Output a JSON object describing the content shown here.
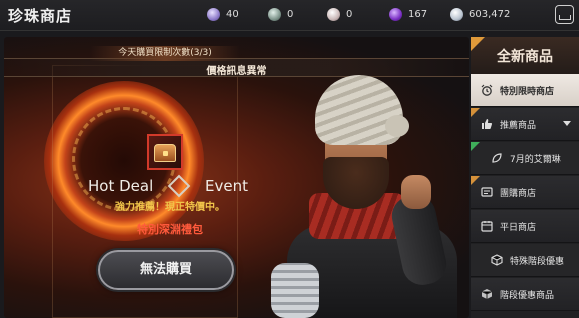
{
  "header": {
    "title": "珍珠商店",
    "currencies": [
      {
        "icon": "purple-pearl-icon",
        "value": "40"
      },
      {
        "icon": "gray-stone-icon",
        "value": "0"
      },
      {
        "icon": "white-orb-icon",
        "value": "0"
      },
      {
        "icon": "violet-gem-icon",
        "value": "167"
      },
      {
        "icon": "silver-coin-icon",
        "value": "603,472"
      }
    ],
    "close_icon": "exit-icon"
  },
  "main": {
    "limit_text": "今天購買限制次數(3/3)",
    "price_notice": "價格訊息異常",
    "hot_deal_left": "Hot Deal",
    "hot_deal_right": "Event",
    "promo_line": "強力推薦！現正特價中。",
    "product_name": "特別深淵禮包",
    "buy_button": "無法購買"
  },
  "sidebar": {
    "header": "全新商品",
    "items": [
      {
        "label": "特別限時商店",
        "icon": "alarm-clock-icon",
        "active": true
      },
      {
        "label": "推薦商品",
        "icon": "thumbs-up-icon",
        "expand": true
      },
      {
        "label": "7月的艾爾琳",
        "icon": "leaf-icon",
        "sub": true
      },
      {
        "label": "團購商店",
        "icon": "group-icon"
      },
      {
        "label": "平日商店",
        "icon": "calendar-icon"
      },
      {
        "label": "特殊階段優惠",
        "icon": "box-icon",
        "sub": true
      },
      {
        "label": "階段優惠商品",
        "icon": "cube-icon"
      }
    ]
  }
}
